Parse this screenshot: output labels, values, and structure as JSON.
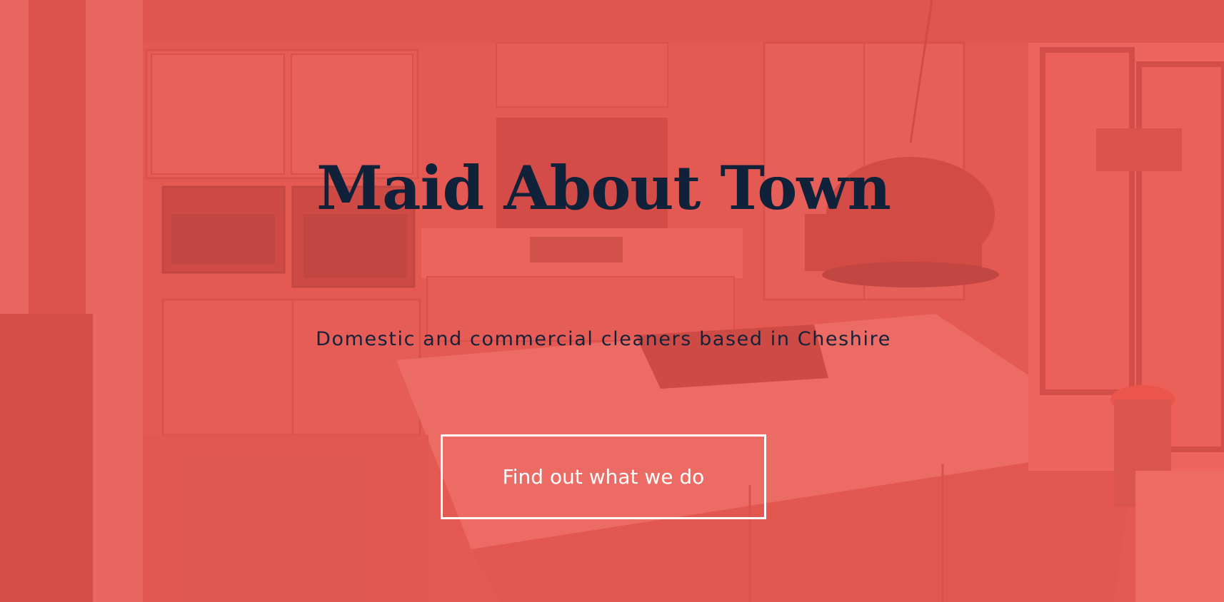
{
  "hero": {
    "title": "Maid About Town",
    "subtitle": "Domestic and commercial cleaners based in Cheshire",
    "cta_label": "Find out what we do"
  },
  "colors": {
    "overlay": "#e85e57",
    "title": "#10213a",
    "subtitle": "#14223a",
    "button_border": "#ffffff",
    "button_text": "#ffffff"
  }
}
